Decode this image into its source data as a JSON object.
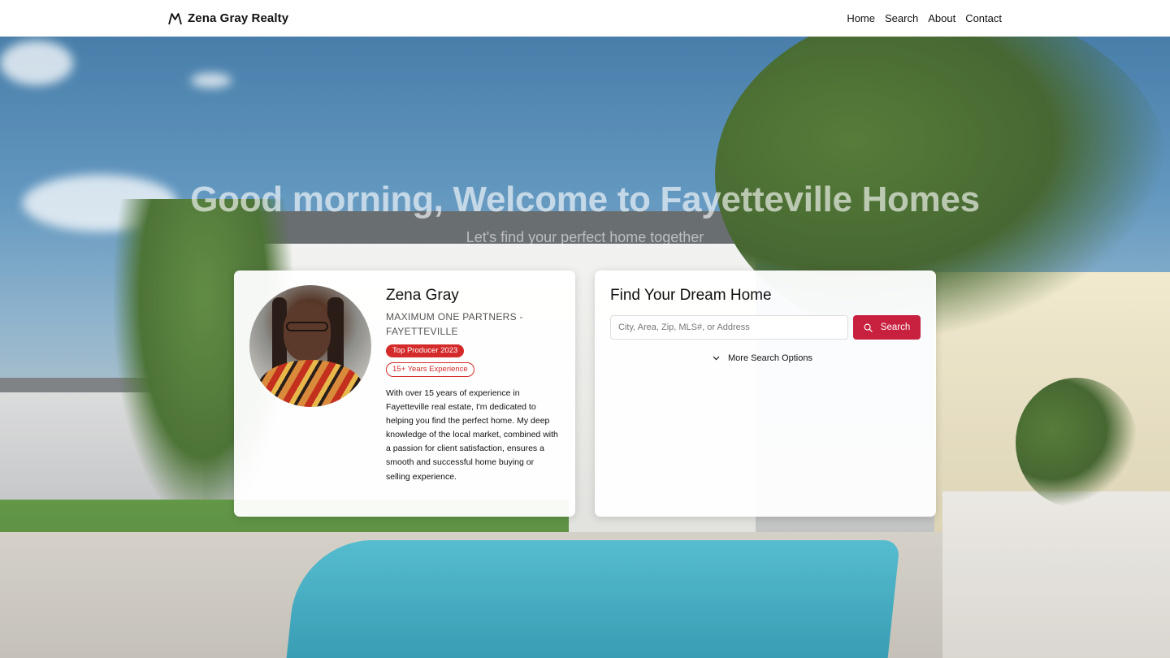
{
  "header": {
    "brand": "Zena Gray Realty",
    "brand_icon": "mountain-logo-icon",
    "nav": [
      {
        "label": "Home"
      },
      {
        "label": "Search"
      },
      {
        "label": "About"
      },
      {
        "label": "Contact"
      }
    ]
  },
  "hero": {
    "title": "Good morning, Welcome to Fayetteville Homes",
    "subtitle": "Let's find your perfect home together"
  },
  "agent": {
    "name": "Zena Gray",
    "company": "MAXIMUM ONE PARTNERS - FAYETTEVILLE",
    "badges": [
      "Top Producer 2023",
      "15+ Years Experience"
    ],
    "bio": "With over 15 years of experience in Fayetteville real estate, I'm dedicated to helping you find the perfect home. My deep knowledge of the local market, combined with a passion for client satisfaction, ensures a smooth and successful home buying or selling experience."
  },
  "search": {
    "title": "Find Your Dream Home",
    "placeholder": "City, Area, Zip, MLS#, or Address",
    "button_label": "Search",
    "button_icon": "search-icon",
    "more_options": "More Search Options",
    "more_options_icon": "chevron-down-icon"
  },
  "colors": {
    "accent": "#c8203f",
    "badge_red": "#d52a2a"
  }
}
